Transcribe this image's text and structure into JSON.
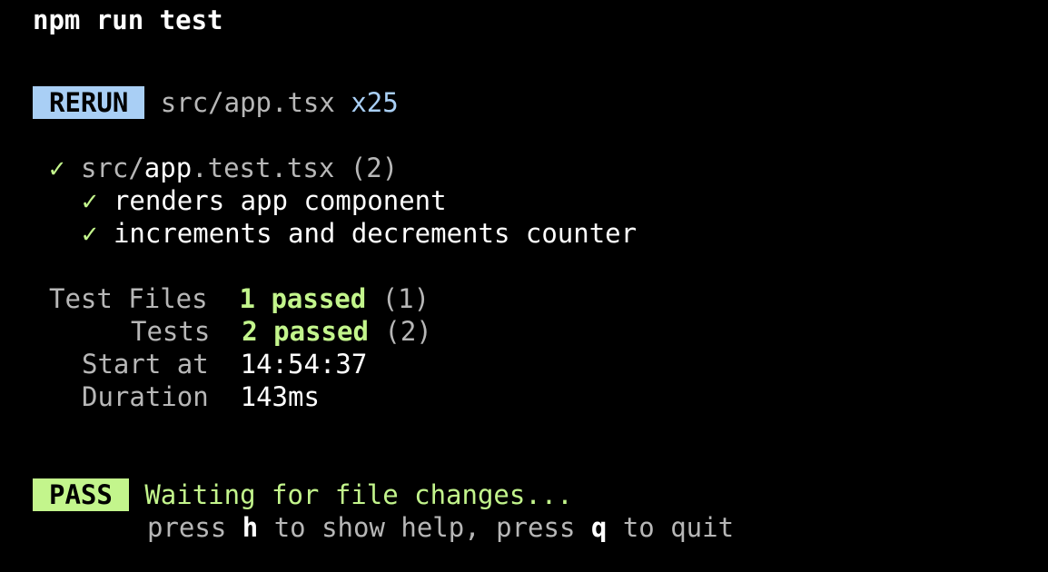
{
  "command": "npm run test",
  "rerun": {
    "badge": "RERUN",
    "file": "src/app.tsx",
    "count": "x25"
  },
  "suite": {
    "check": "✓",
    "path_prefix": "src/",
    "path_file": "app",
    "path_suffix": ".test.tsx",
    "count": "(2)",
    "tests": [
      {
        "check": "✓",
        "name": "renders app component"
      },
      {
        "check": "✓",
        "name": "increments and decrements counter"
      }
    ]
  },
  "summary": {
    "test_files_label": "Test Files",
    "test_files_passed": "1 passed",
    "test_files_total": "(1)",
    "tests_label": "Tests",
    "tests_passed": "2 passed",
    "tests_total": "(2)",
    "start_label": "Start at",
    "start_value": "14:54:37",
    "duration_label": "Duration",
    "duration_value": "143ms"
  },
  "status": {
    "badge": "PASS",
    "message": "Waiting for file changes...",
    "hint_press1": "press ",
    "hint_key1": "h",
    "hint_mid": " to show help, press ",
    "hint_key2": "q",
    "hint_end": " to quit"
  },
  "colors": {
    "background": "#000000",
    "text": "#ffffff",
    "muted": "#b7b7b7",
    "pass_green": "#c3f58c",
    "rerun_blue": "#a9cff5"
  }
}
